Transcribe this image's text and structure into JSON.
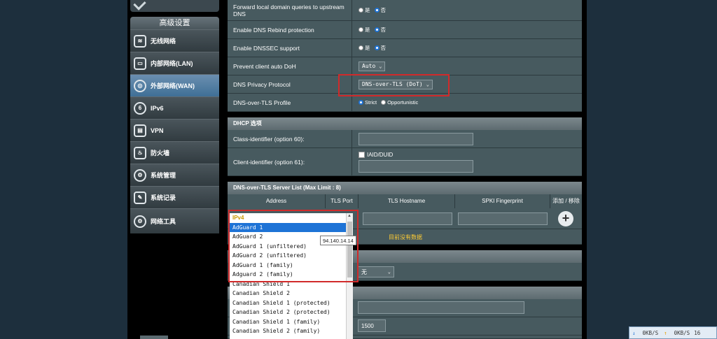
{
  "sidebar": {
    "header": "高级设置",
    "items": [
      {
        "label": "无线网络",
        "icon": "wireless-icon"
      },
      {
        "label": "内部网络(LAN)",
        "icon": "lan-icon"
      },
      {
        "label": "外部网络(WAN)",
        "icon": "wan-globe-icon"
      },
      {
        "label": "IPv6",
        "icon": "ipv6-icon"
      },
      {
        "label": "VPN",
        "icon": "vpn-icon"
      },
      {
        "label": "防火墙",
        "icon": "firewall-icon"
      },
      {
        "label": "系统管理",
        "icon": "admin-gear-icon"
      },
      {
        "label": "系统记录",
        "icon": "log-icon"
      },
      {
        "label": "网络工具",
        "icon": "network-tools-icon"
      }
    ]
  },
  "settings": {
    "forward_local": {
      "label": "Forward local domain queries to upstream DNS",
      "opt_yes": "是",
      "opt_no": "否"
    },
    "rebind": {
      "label": "Enable DNS Rebind protection",
      "opt_yes": "是",
      "opt_no": "否"
    },
    "dnssec": {
      "label": "Enable DNSSEC support",
      "opt_yes": "是",
      "opt_no": "否"
    },
    "prevent_doh": {
      "label": "Prevent client auto DoH",
      "value": "Auto"
    },
    "privacy": {
      "label": "DNS Privacy Protocol",
      "value": "DNS-over-TLS (DoT)"
    },
    "dot_profile": {
      "label": "DNS-over-TLS Profile",
      "opt_strict": "Strict",
      "opt_opp": "Opportunistic"
    }
  },
  "dhcp": {
    "title": "DHCP 选项",
    "class_id": {
      "label": "Class-identifier (option 60):"
    },
    "client_id": {
      "label": "Client-identifier (option 61):",
      "checkbox": "IAID/DUID"
    }
  },
  "dot_list": {
    "title": "DNS-over-TLS Server List (Max Limit : 8)",
    "columns": [
      "Address",
      "TLS Port",
      "TLS Hostname",
      "SPKI Fingerprint",
      "添加 / 移除"
    ],
    "no_data": "目前没有数据"
  },
  "dropdown": {
    "group": "IPv4",
    "items": [
      "AdGuard 1",
      "AdGuard 2",
      "AdGuard 1 (unfiltered)",
      "AdGuard 2 (unfiltered)",
      "AdGuard 1 (family)",
      "Adguard 2 (family)",
      "Canadian Shield 1",
      "Canadian Shield 2",
      "Canadian Shield 1 (protected)",
      "Canadian Shield 2 (protected)",
      "Canadian Shield 1 (family)",
      "Canadian Shield 2 (family)"
    ],
    "selected": "AdGuard 1",
    "tooltip": "94.140.14.14"
  },
  "lower": {
    "select_value": "无",
    "port_value": "1500"
  },
  "status": {
    "down": "0KB/S",
    "up": "0KB/S",
    "extra": "16"
  }
}
